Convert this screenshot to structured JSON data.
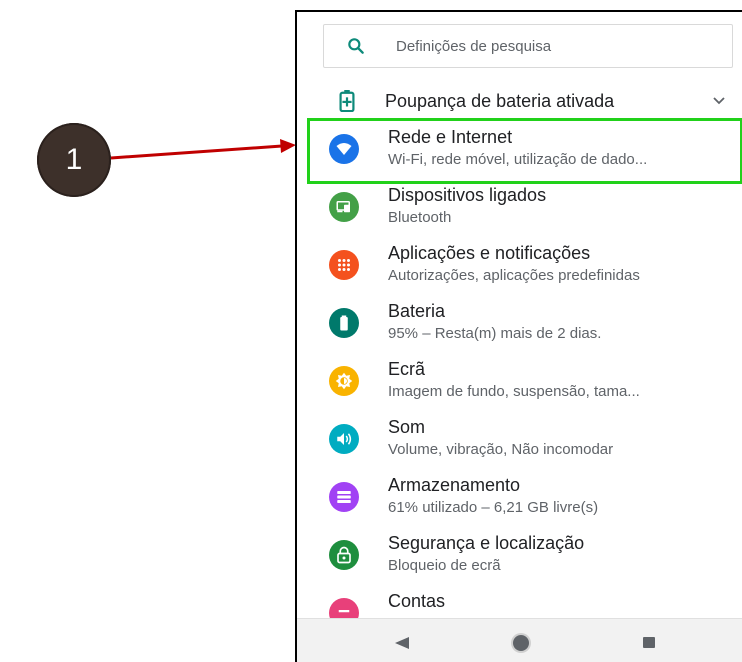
{
  "annotation": {
    "number": "1"
  },
  "search": {
    "placeholder": "Definições de pesquisa"
  },
  "battery_saver": {
    "label": "Poupança de bateria ativada"
  },
  "items": [
    {
      "title": "Rede e Internet",
      "subtitle": "Wi-Fi, rede móvel, utilização de dado...",
      "icon": "wifi-icon",
      "color": "#1a73e8"
    },
    {
      "title": "Dispositivos ligados",
      "subtitle": "Bluetooth",
      "icon": "connected-devices-icon",
      "color": "#43a047"
    },
    {
      "title": "Aplicações e notificações",
      "subtitle": "Autorizações, aplicações predefinidas",
      "icon": "apps-grid-icon",
      "color": "#f4511e"
    },
    {
      "title": "Bateria",
      "subtitle": "95% – Resta(m) mais de 2 dias.",
      "icon": "battery-icon",
      "color": "#00796b"
    },
    {
      "title": "Ecrã",
      "subtitle": "Imagem de fundo, suspensão, tama...",
      "icon": "brightness-icon",
      "color": "#f9b300"
    },
    {
      "title": "Som",
      "subtitle": "Volume, vibração, Não incomodar",
      "icon": "volume-icon",
      "color": "#00acc1"
    },
    {
      "title": "Armazenamento",
      "subtitle": "61% utilizado – 6,21 GB livre(s)",
      "icon": "storage-icon",
      "color": "#a142f4"
    },
    {
      "title": "Segurança e localização",
      "subtitle": "Bloqueio de ecrã",
      "icon": "lock-icon",
      "color": "#1e8e3e"
    },
    {
      "title": "Contas",
      "subtitle": "",
      "icon": "account-icon",
      "color": "#e8407a"
    }
  ],
  "colors": {
    "highlight": "#21d11a",
    "arrow": "#c00000",
    "badge": "#3d302a"
  }
}
